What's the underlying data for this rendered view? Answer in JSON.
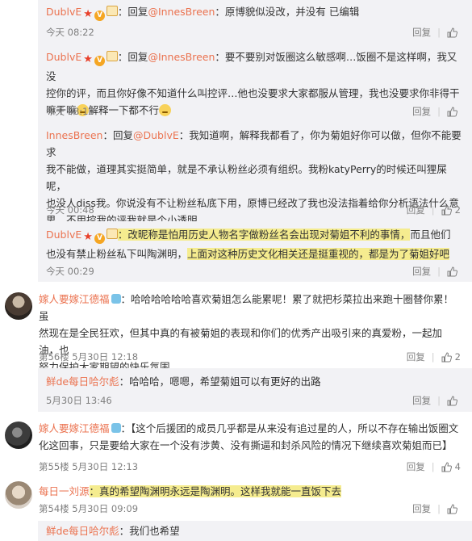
{
  "reply_label": "回复",
  "colors": {
    "link": "#eb7350",
    "highlight": "#f5ec8f",
    "reply_bg": "#f2f2f5"
  },
  "comments": [
    {
      "user": "DublvE",
      "text_pre": "：回复",
      "at": "@InnesBreen",
      "text": "：原博貌似没改，并没有 已编辑",
      "time": "今天 08:22",
      "likes": "",
      "badges": [
        "star",
        "v",
        "card"
      ]
    },
    {
      "user": "DublvE",
      "text_pre": "：回复",
      "at": "@InnesBreen",
      "line1": "：要不要别对饭圈这么敏感啊…饭圈不是这样啊，我又没",
      "line2": "控你的评，而且你好像不知道什么叫控评…他也没要求大家都服从管理，我也没要求你非得干",
      "line3": "嘛干嘛",
      "line3b": "解释一下都不行",
      "time": "今天 08:18",
      "likes": "",
      "badges": [
        "star",
        "v",
        "card"
      ],
      "emoji": [
        "sad-face-icon",
        "sweat-face-icon"
      ]
    },
    {
      "user": "InnesBreen",
      "text_pre": "：回复",
      "at": "@DublvE",
      "line1": "：我知道啊，解释我都看了，你为菊姐好你可以做，但你不能要求",
      "line2": "我不能做，道理其实挺简单，就是不承认粉丝必须有组织。我粉katyPerry的时候还叫狸屎呢，",
      "line3": "也没人diss我。你说没有不让粉丝私底下用，原博已经改了我也没法指着给你分析语法什么意",
      "line4": "思。不用控我的评我就是个小透明。",
      "time": "今天 00:48",
      "likes": "2"
    },
    {
      "user": "DublvE",
      "line1_hl": "：改昵称是怕用历史人物名字做粉丝名会出现对菊姐不利的事情，",
      "line1_rest": "而且他们",
      "line2_pre": "也没有禁止粉丝私下叫陶渊明，",
      "line2_hl": "上面对这种历史文化相关还是挺重视的，都是为了菊姐好吧",
      "time": "今天 00:29",
      "likes": "",
      "badges": [
        "star",
        "v",
        "card"
      ]
    },
    {
      "user": "嫁人要嫁江德福",
      "line1": "：哈哈哈哈哈哈喜欢菊姐怎么能累呢！累了就把杉菜拉出来跑十圈替你累！虽",
      "line2": "然现在是全民狂欢，但其中真的有被菊姐的表现和你们的优秀产出吸引来的真爱粉，一起加油，也",
      "line3": "努力保护大家期望的快乐氛围",
      "time": "第56楼 5月30日 12:18",
      "likes": "2",
      "badges": [
        "sky"
      ]
    },
    {
      "user": "鲜de每日哈尔彪",
      "text": "：哈哈哈，嗯嗯，希望菊姐可以有更好的出路",
      "time": "5月30日 13:46",
      "likes": ""
    },
    {
      "user": "嫁人要嫁江德福",
      "line1": "：【这个后援团的成员几乎都是从来没有追过星的人，所以不存在输出饭圈文",
      "line2": "化这回事，只是要给大家在一个没有涉黄、没有撕逼和封杀风险的情况下继续喜欢菊姐而已】",
      "time": "第55楼 5月30日 12:13",
      "likes": "4",
      "badges": [
        "sky"
      ]
    },
    {
      "user": "每日一刘源",
      "text_hl": "：真的希望陶渊明永远是陶渊明。这样我就能一直饭下去",
      "time": "第54楼 5月30日 09:09",
      "likes": ""
    },
    {
      "user": "鲜de每日哈尔彪",
      "text": "：我们也希望"
    }
  ]
}
